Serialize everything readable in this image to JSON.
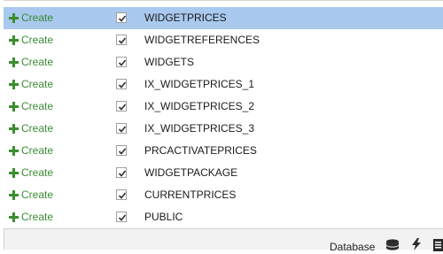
{
  "rows": [
    {
      "action": "Create",
      "checked": true,
      "name": "WIDGETPRICES",
      "selected": true
    },
    {
      "action": "Create",
      "checked": true,
      "name": "WIDGETREFERENCES",
      "selected": false
    },
    {
      "action": "Create",
      "checked": true,
      "name": "WIDGETS",
      "selected": false
    },
    {
      "action": "Create",
      "checked": true,
      "name": "IX_WIDGETPRICES_1",
      "selected": false
    },
    {
      "action": "Create",
      "checked": true,
      "name": "IX_WIDGETPRICES_2",
      "selected": false
    },
    {
      "action": "Create",
      "checked": true,
      "name": "IX_WIDGETPRICES_3",
      "selected": false
    },
    {
      "action": "Create",
      "checked": true,
      "name": "PRCACTIVATEPRICES",
      "selected": false
    },
    {
      "action": "Create",
      "checked": true,
      "name": "WIDGETPACKAGE",
      "selected": false
    },
    {
      "action": "Create",
      "checked": true,
      "name": "CURRENTPRICES",
      "selected": false
    },
    {
      "action": "Create",
      "checked": true,
      "name": "PUBLIC",
      "selected": false
    }
  ],
  "footer": {
    "label": "Database",
    "icons": [
      "database-icon",
      "lightning-icon",
      "document-icon"
    ]
  },
  "colors": {
    "selected_row": "#a9c9ef",
    "create_green": "#3a8a33"
  }
}
